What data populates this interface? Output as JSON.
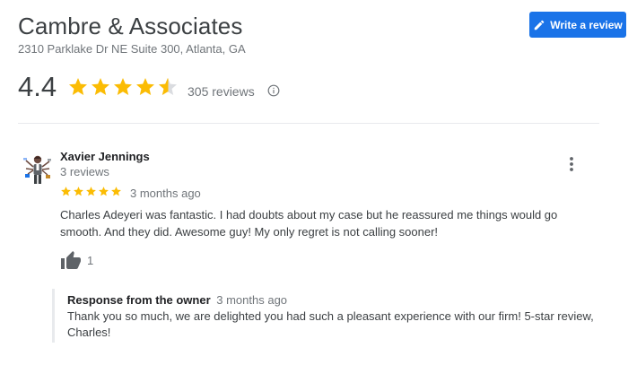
{
  "business": {
    "name": "Cambre & Associates",
    "address": "2310 Parklake Dr NE Suite 300, Atlanta, GA",
    "rating": "4.4",
    "rating_value": 4.4,
    "review_count_label": "305 reviews",
    "write_review_label": "Write a review"
  },
  "review": {
    "author": "Xavier Jennings",
    "author_meta": "3 reviews",
    "stars": 5,
    "time": "3 months ago",
    "text": "Charles Adeyeri was fantastic. I had doubts about my case but he reassured me things would go smooth. And they did. Awesome guy! My only regret is not calling sooner!",
    "likes": "1"
  },
  "owner_response": {
    "label": "Response from the owner",
    "time": "3 months ago",
    "text": "Thank you so much, we are delighted you had such a pleasant experience with our firm! 5-star review, Charles!"
  },
  "colors": {
    "accent": "#1a73e8",
    "star": "#fbbc04",
    "star_empty": "#dadce0",
    "muted_text": "#70757a"
  },
  "icons": {
    "write": "pencil-icon",
    "info": "info-icon",
    "more": "more-vert-icon",
    "like": "thumb-up-icon",
    "star": "star-icon"
  }
}
